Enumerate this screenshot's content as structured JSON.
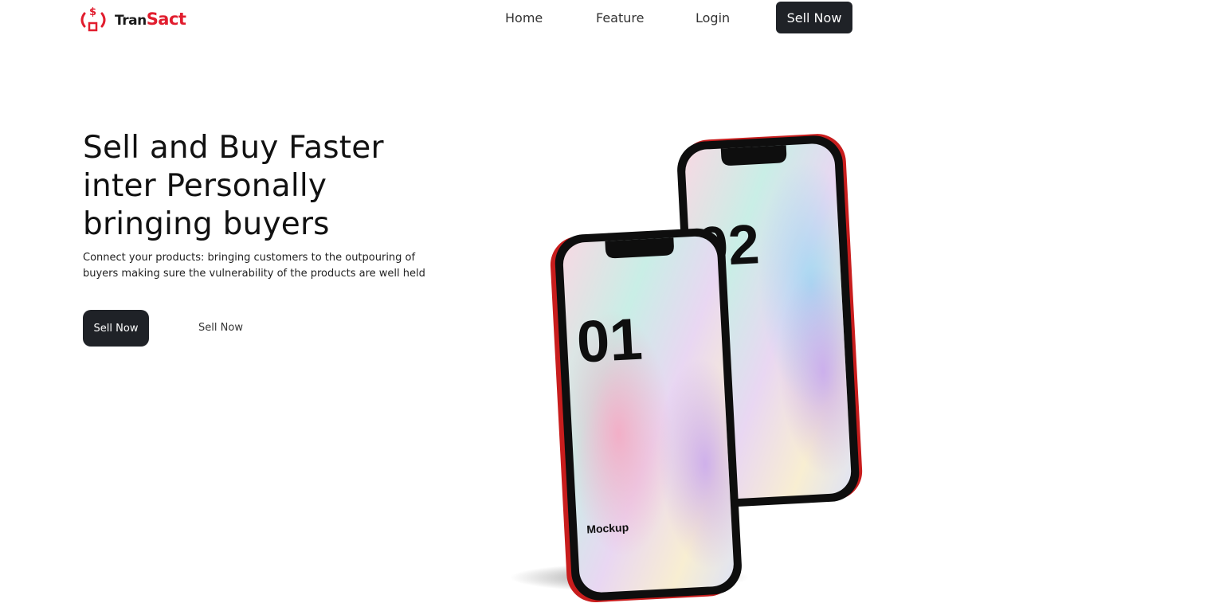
{
  "brand": {
    "name_part1": "Tran",
    "name_part2": "Sact",
    "accent": "#e11d2e"
  },
  "nav": {
    "items": [
      {
        "label": "Home"
      },
      {
        "label": "Feature"
      },
      {
        "label": "Login"
      }
    ],
    "cta_label": "Sell Now"
  },
  "hero": {
    "title_lines": [
      "Sell and Buy Faster",
      "inter Personally",
      "bringing buyers"
    ],
    "description": "Connect your products: bringing customers to the outpouring of buyers making sure the vulnerability of the products are well held",
    "primary_button": "Sell Now",
    "secondary_button": "Sell Now"
  },
  "mockup": {
    "front_number": "01",
    "back_number": "02",
    "front_caption": "Mockup"
  },
  "colors": {
    "dark_button": "#1f2227",
    "phone_frame": "#d41f1f"
  }
}
